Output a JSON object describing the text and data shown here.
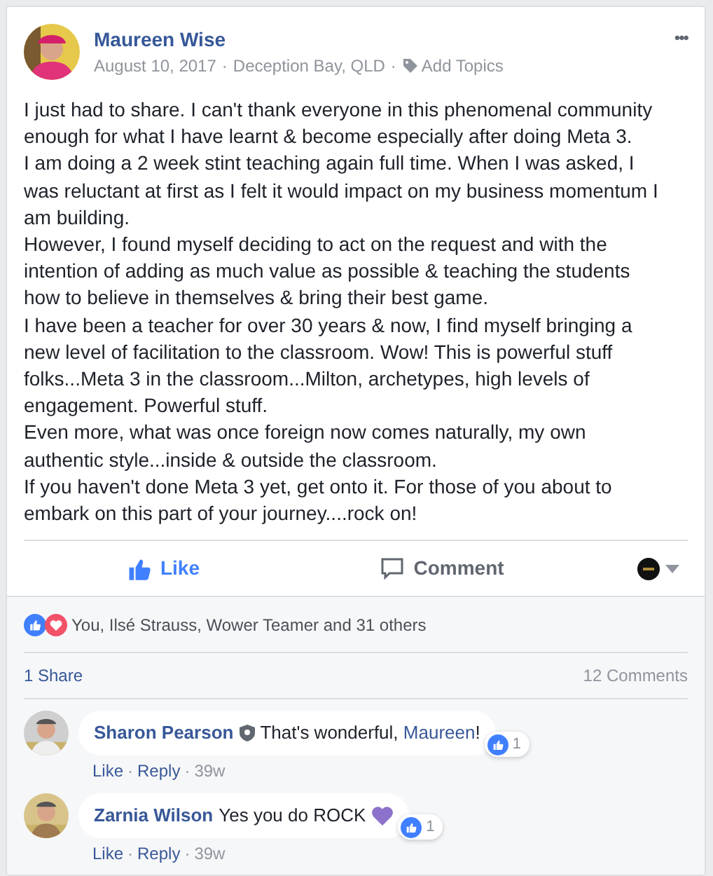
{
  "post": {
    "author": "Maureen Wise",
    "date": "August 10, 2017",
    "location": "Deception Bay, QLD",
    "add_topics": "Add Topics",
    "separators": [
      "·",
      "·"
    ],
    "more": "•••",
    "paragraphs": [
      "I just had to share. I can't thank everyone in this phenomenal community enough for what I have learnt & become especially after doing Meta 3.",
      "I am doing a 2 week stint teaching again full time. When I was asked, I was reluctant at first as I felt it would impact on my business momentum I am building.",
      "However, I found myself deciding to act on the request and with the intention of adding as much value as possible & teaching the students how to believe in themselves & bring their best game.",
      "I have been a teacher for over 30 years & now, I find myself bringing a new level of facilitation to the classroom. Wow! This is powerful stuff folks...Meta 3 in the classroom...Milton, archetypes, high levels of engagement. Powerful stuff.",
      "Even more, what was once foreign now comes naturally, my own authentic style...inside & outside the classroom.",
      "If you haven't done Meta 3 yet, get onto it. For those of you about to embark on this part of your journey....rock on!"
    ]
  },
  "actions": [
    {
      "kind": "like",
      "label": "Like",
      "selected": true
    },
    {
      "kind": "comment",
      "label": "Comment",
      "selected": false
    }
  ],
  "reactions": {
    "text": "You, Ilsé Strauss, Wower Teamer and 31 others"
  },
  "stats": {
    "shares": "1 Share",
    "comments": "12 Comments"
  },
  "comments": [
    {
      "author": "Sharon Pearson",
      "badge": true,
      "parts": [
        {
          "kind": "text",
          "text": "That's wonderful, "
        },
        {
          "kind": "mention",
          "text": "Maureen"
        },
        {
          "kind": "text",
          "text": "!"
        }
      ],
      "heart": false,
      "likes": "1",
      "links": [
        "Like",
        "Reply"
      ],
      "separators": [
        "·",
        "·"
      ],
      "time": "39w"
    },
    {
      "author": "Zarnia Wilson",
      "badge": false,
      "parts": [
        {
          "kind": "text",
          "text": "Yes you do ROCK"
        }
      ],
      "heart": true,
      "likes": "1",
      "links": [
        "Like",
        "Reply"
      ],
      "separators": [
        "·",
        "·"
      ],
      "time": "39w"
    }
  ]
}
